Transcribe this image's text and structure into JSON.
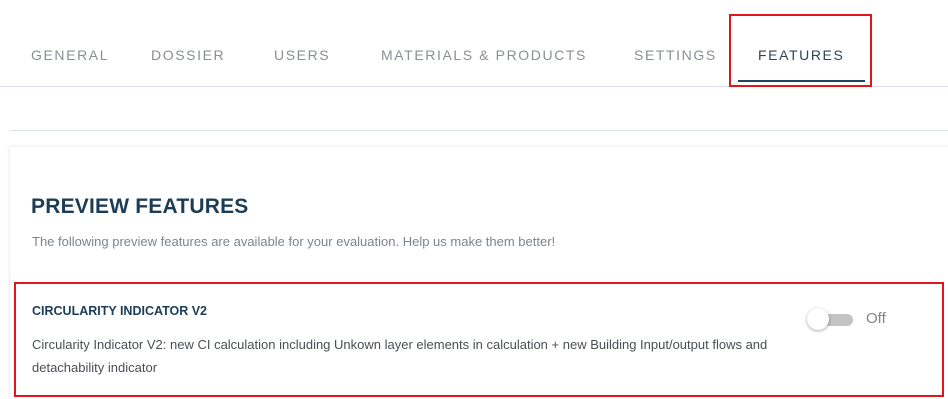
{
  "tabs": [
    {
      "label": "GENERAL"
    },
    {
      "label": "DOSSIER"
    },
    {
      "label": "USERS"
    },
    {
      "label": "MATERIALS & PRODUCTS"
    },
    {
      "label": "SETTINGS"
    },
    {
      "label": "FEATURES",
      "active": true
    }
  ],
  "section": {
    "title": "PREVIEW FEATURES",
    "description": "The following preview features are available for your evaluation. Help us make them better!"
  },
  "features": [
    {
      "title": "CIRCULARITY INDICATOR V2",
      "description": "Circularity Indicator V2: new CI calculation including Unkown layer elements in calculation + new Building Input/output flows and detachability indicator",
      "toggle_state": "Off",
      "enabled": false
    }
  ],
  "colors": {
    "highlight": "#e0161d",
    "heading": "#1b3d57",
    "active_tab_underline": "#1f4560"
  }
}
